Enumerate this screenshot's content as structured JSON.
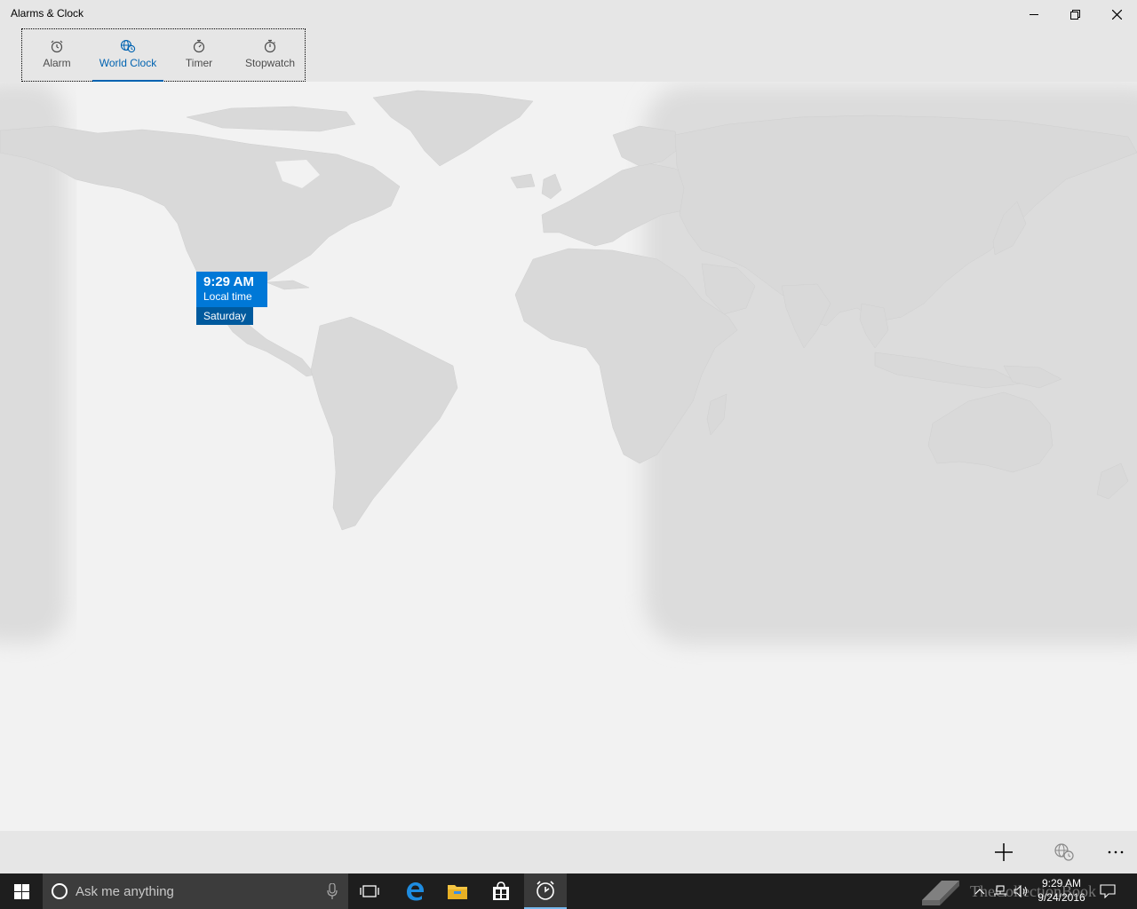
{
  "window": {
    "title": "Alarms & Clock",
    "controls": {
      "minimize": "minimize",
      "restore": "restore",
      "close": "close"
    }
  },
  "nav": {
    "tabs": [
      {
        "label": "Alarm",
        "icon": "alarm-clock-icon"
      },
      {
        "label": "World Clock",
        "icon": "globe-clock-icon",
        "active": true
      },
      {
        "label": "Timer",
        "icon": "timer-icon"
      },
      {
        "label": "Stopwatch",
        "icon": "stopwatch-icon"
      }
    ]
  },
  "map": {
    "local_clock": {
      "time": "9:29 AM",
      "label": "Local time",
      "day": "Saturday"
    }
  },
  "commandbar": {
    "buttons": [
      {
        "name": "add",
        "icon": "plus-icon"
      },
      {
        "name": "compare",
        "icon": "compare-clock-icon"
      },
      {
        "name": "more",
        "icon": "more-icon"
      }
    ]
  },
  "taskbar": {
    "search_placeholder": "Ask me anything",
    "pinned": [
      "task-view-icon",
      "edge-icon",
      "file-explorer-icon",
      "store-icon",
      "alarms-clock-icon"
    ],
    "tray": {
      "time": "9:29 AM",
      "date": "9/24/2016"
    },
    "watermark": "TheCollectionBook"
  },
  "colors": {
    "accent": "#0078d7",
    "accent_dark": "#005a9e",
    "chrome": "#e6e6e6",
    "background": "#f2f2f2",
    "taskbar": "#1e1e1e"
  }
}
